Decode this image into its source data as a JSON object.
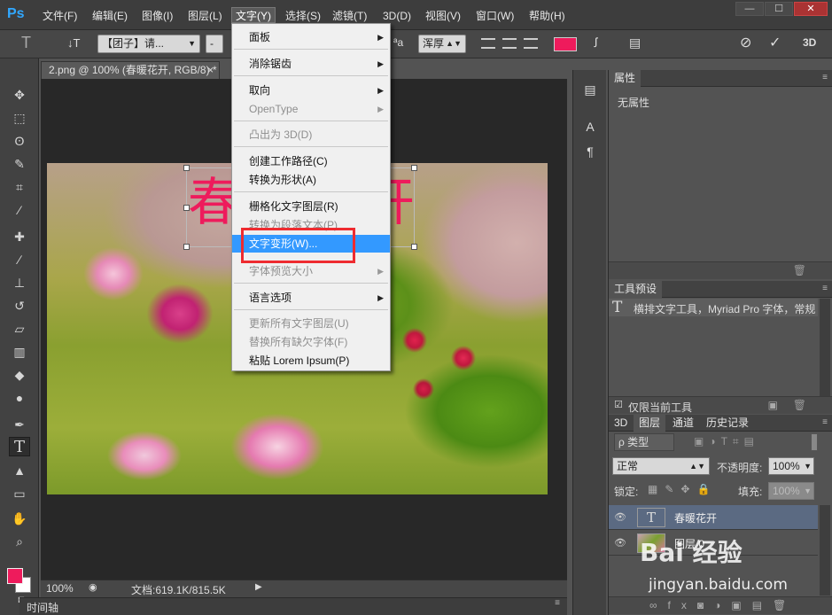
{
  "app": {
    "logo": "Ps"
  },
  "menubar": {
    "items": [
      "文件(F)",
      "编辑(E)",
      "图像(I)",
      "图层(L)",
      "文字(Y)",
      "选择(S)",
      "滤镜(T)",
      "3D(D)",
      "视图(V)",
      "窗口(W)",
      "帮助(H)"
    ],
    "active_index": 4,
    "window_buttons": [
      "—",
      "☐",
      "✕"
    ]
  },
  "options": {
    "tool_icon": "T",
    "orient_icon": "↓T",
    "font_family": "【团子】请...",
    "font_style": "-",
    "aa_label": "ªa",
    "aa_mode": "浑厚",
    "text_color": "#ee1b5c",
    "right_icons": [
      "⊘",
      "✓",
      "3D"
    ]
  },
  "document": {
    "tab_title": "2.png @ 100% (春暖花开, RGB/8) *",
    "tab_close": "×",
    "canvas_text": "春暖花开",
    "zoom": "100%",
    "doc_info": "文档:619.1K/815.5K",
    "timeline": "时间轴"
  },
  "tools": [
    {
      "icon": "move-icon",
      "glyph": "✥"
    },
    {
      "icon": "marquee-icon",
      "glyph": "⬚"
    },
    {
      "icon": "lasso-icon",
      "glyph": "ʘ"
    },
    {
      "icon": "quick-select-icon",
      "glyph": "✎"
    },
    {
      "icon": "crop-icon",
      "glyph": "⌗"
    },
    {
      "icon": "eyedropper-icon",
      "glyph": "⁄"
    },
    {
      "icon": "healing-icon",
      "glyph": "✚"
    },
    {
      "icon": "brush-icon",
      "glyph": "∕"
    },
    {
      "icon": "stamp-icon",
      "glyph": "⊥"
    },
    {
      "icon": "history-brush-icon",
      "glyph": "↺"
    },
    {
      "icon": "eraser-icon",
      "glyph": "▱"
    },
    {
      "icon": "gradient-icon",
      "glyph": "▥"
    },
    {
      "icon": "blur-icon",
      "glyph": "◆"
    },
    {
      "icon": "dodge-icon",
      "glyph": "●"
    },
    {
      "icon": "pen-icon",
      "glyph": "✒"
    },
    {
      "icon": "type-icon",
      "glyph": "T"
    },
    {
      "icon": "path-select-icon",
      "glyph": "▲"
    },
    {
      "icon": "shape-icon",
      "glyph": "▭"
    },
    {
      "icon": "hand-icon",
      "glyph": "✋"
    },
    {
      "icon": "zoom-icon",
      "glyph": "⌕"
    }
  ],
  "colors": {
    "foreground": "#ee1b5c",
    "background": "#ffffff",
    "highlight": "#3399ff",
    "annotation": "#ee2b30"
  },
  "type_menu": {
    "items": [
      {
        "label": "面板",
        "submenu": true,
        "disabled": false
      },
      {
        "label": "消除锯齿",
        "submenu": true,
        "disabled": false
      },
      {
        "label": "取向",
        "submenu": true,
        "disabled": false
      },
      {
        "label": "OpenType",
        "submenu": true,
        "disabled": true
      },
      {
        "label": "凸出为 3D(D)",
        "submenu": false,
        "disabled": true
      },
      {
        "label": "创建工作路径(C)",
        "submenu": false,
        "disabled": false
      },
      {
        "label": "转换为形状(A)",
        "submenu": false,
        "disabled": false
      },
      {
        "label": "栅格化文字图层(R)",
        "submenu": false,
        "disabled": false
      },
      {
        "label": "转换为段落文本(P)",
        "submenu": false,
        "disabled": true
      },
      {
        "label": "文字变形(W)...",
        "submenu": false,
        "disabled": false,
        "highlighted": true
      },
      {
        "label": "字体预览大小",
        "submenu": true,
        "disabled": true
      },
      {
        "label": "语言选项",
        "submenu": true,
        "disabled": false
      },
      {
        "label": "更新所有文字图层(U)",
        "submenu": false,
        "disabled": true
      },
      {
        "label": "替换所有缺欠字体(F)",
        "submenu": false,
        "disabled": true
      },
      {
        "label": "粘贴 Lorem Ipsum(P)",
        "submenu": false,
        "disabled": false
      }
    ]
  },
  "properties_panel": {
    "title": "属性",
    "empty_text": "无属性"
  },
  "tool_presets_panel": {
    "title": "工具预设",
    "item": "横排文字工具，Myriad Pro 字体，常规",
    "current_only": "仅限当前工具"
  },
  "layers_panel": {
    "tabs": [
      "3D",
      "图层",
      "通道",
      "历史记录"
    ],
    "active_tab": 1,
    "filter_label": "ρ 类型",
    "blend_mode": "正常",
    "opacity_label": "不透明度:",
    "opacity_value": "100%",
    "lock_label": "锁定:",
    "fill_label": "填充:",
    "fill_value": "100%",
    "layers": [
      {
        "name": "春暖花开",
        "type": "text",
        "selected": true
      },
      {
        "name": "图层 0",
        "type": "image",
        "selected": false
      }
    ]
  },
  "watermark": {
    "logo": "Bai 经验",
    "url": "jingyan.baidu.com"
  }
}
